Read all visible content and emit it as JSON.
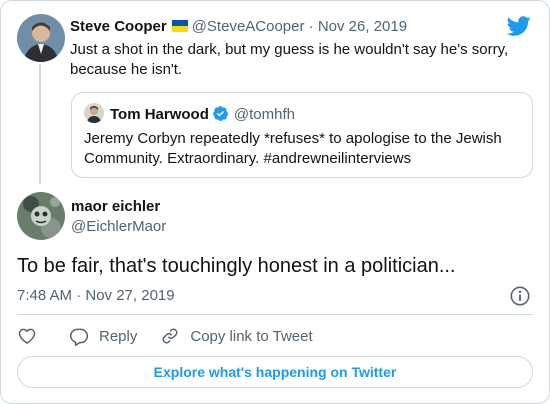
{
  "parent_tweet": {
    "author_name": "Steve Cooper",
    "author_flag": "ukraine-flag-icon",
    "author_handle": "@SteveACooper",
    "separator": "·",
    "date": "Nov 26, 2019",
    "text": "Just a shot in the dark, but my guess is he wouldn't say he's sorry, because he isn't."
  },
  "quoted_tweet": {
    "author_name": "Tom Harwood",
    "verified": true,
    "author_handle": "@tomhfh",
    "text": "Jeremy Corbyn repeatedly *refuses* to apologise to the Jewish Community. Extraordinary. #andrewneilinterviews"
  },
  "main_tweet": {
    "author_name": "maor eichler",
    "author_handle": "@EichlerMaor",
    "text": "To be fair, that's touchingly honest in a politician...",
    "timestamp": "7:48 AM · Nov 27, 2019"
  },
  "actions": {
    "like_icon": "heart-icon",
    "reply_label": "Reply",
    "copy_link_label": "Copy link to Tweet"
  },
  "explore_label": "Explore what's happening on Twitter",
  "icons": {
    "brand": "twitter-bird-icon",
    "info": "info-icon"
  },
  "colors": {
    "twitter_blue": "#1d9bf0",
    "secondary_text": "#536471",
    "border": "#cfd9de",
    "flag_blue": "#0057b7",
    "flag_yellow": "#ffd700"
  }
}
